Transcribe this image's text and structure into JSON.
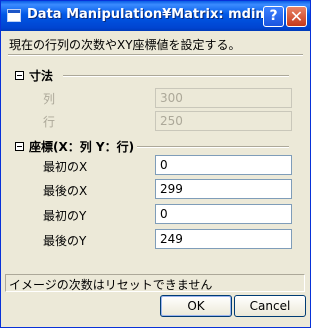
{
  "window": {
    "title": "Data Manipulation¥Matrix: mdim",
    "help_label": "?",
    "close_label": "✕"
  },
  "description": "現在の行列の次数やXY座標値を設定する。",
  "dimensions": {
    "title": "寸法",
    "columns_label": "列",
    "columns_value": "300",
    "rows_label": "行",
    "rows_value": "250"
  },
  "coordinates": {
    "title": "座標(X：列 Y：行)",
    "xmin_label": "最初のX",
    "xmin_value": "0",
    "xmax_label": "最後のX",
    "xmax_value": "299",
    "ymin_label": "最初のY",
    "ymin_value": "0",
    "ymax_label": "最後のY",
    "ymax_value": "249"
  },
  "status": "イメージの次数はリセットできません",
  "buttons": {
    "ok": "OK",
    "cancel": "Cancel"
  }
}
